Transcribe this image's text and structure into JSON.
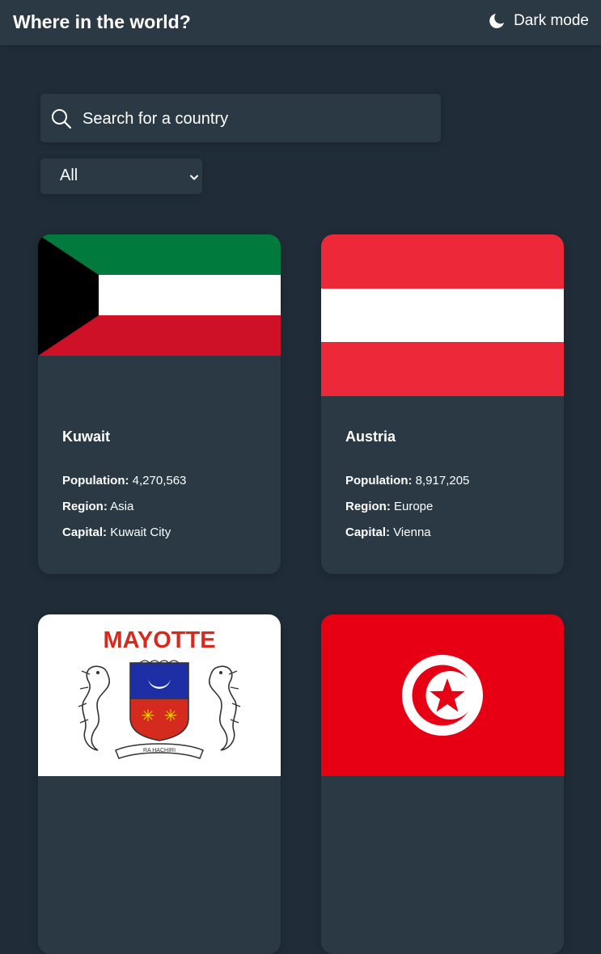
{
  "header": {
    "title": "Where in the world?",
    "mode_label": "Dark mode",
    "mode_icon": "moon-icon"
  },
  "search": {
    "placeholder": "Search for a country",
    "value": "",
    "icon": "search-icon"
  },
  "filter": {
    "selected": "All",
    "icon": "chevron-down-icon"
  },
  "labels": {
    "population": "Population:",
    "region": "Region:",
    "capital": "Capital:"
  },
  "countries": [
    {
      "name": "Kuwait",
      "population": "4,270,563",
      "region": "Asia",
      "capital": "Kuwait City",
      "flag": "kuwait-flag"
    },
    {
      "name": "Austria",
      "population": "8,917,205",
      "region": "Europe",
      "capital": "Vienna",
      "flag": "austria-flag"
    },
    {
      "name": "",
      "population": "",
      "region": "",
      "capital": "",
      "flag": "mayotte-flag",
      "flag_text": "MAYOTTE",
      "flag_motto": "RA HACHIRI"
    },
    {
      "name": "",
      "population": "",
      "region": "",
      "capital": "",
      "flag": "tunisia-flag"
    }
  ],
  "colors": {
    "background": "#202c37",
    "element": "#2b3945",
    "text": "#ffffff"
  }
}
